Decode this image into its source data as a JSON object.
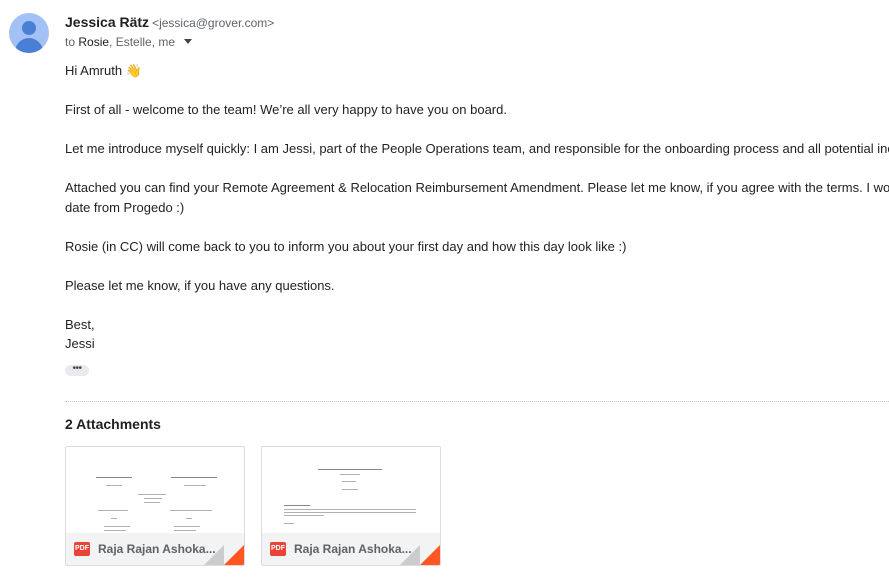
{
  "sender": {
    "name": "Jessica Rätz",
    "email": "<jessica@grover.com>"
  },
  "recipients": {
    "prefix": "to",
    "first": "Rosie",
    "rest": ", Estelle, me"
  },
  "body": {
    "greeting": "Hi Amruth 👋",
    "p1": "First of all - welcome to the team! We’re all very happy to have you on board.",
    "p2": "Let me introduce myself quickly: I am Jessi, part of the People Operations team, and responsible for the onboarding process and all potential inc",
    "p3_line1": "Attached you can find your Remote Agreement & Relocation Reimbursement Amendment. Please let me know, if you agree with the terms. I wo",
    "p3_line2": "date from Progedo :)",
    "p4": "Rosie (in CC) will come back to you to inform you about your first day and how this day look like :)",
    "p5": "Please let me know, if you have any questions.",
    "closing": "Best,",
    "signature": "Jessi"
  },
  "ellipsis": "•••",
  "attachments": {
    "title": "2 Attachments",
    "items": [
      {
        "type_label": "PDF",
        "name": "Raja Rajan Ashoka..."
      },
      {
        "type_label": "PDF",
        "name": "Raja Rajan Ashoka..."
      }
    ]
  },
  "colors": {
    "avatar_bg": "#a3c1f5",
    "avatar_fg": "#4a7fd6",
    "pdf_red": "#ea4335",
    "corner_orange": "#ff5722"
  }
}
